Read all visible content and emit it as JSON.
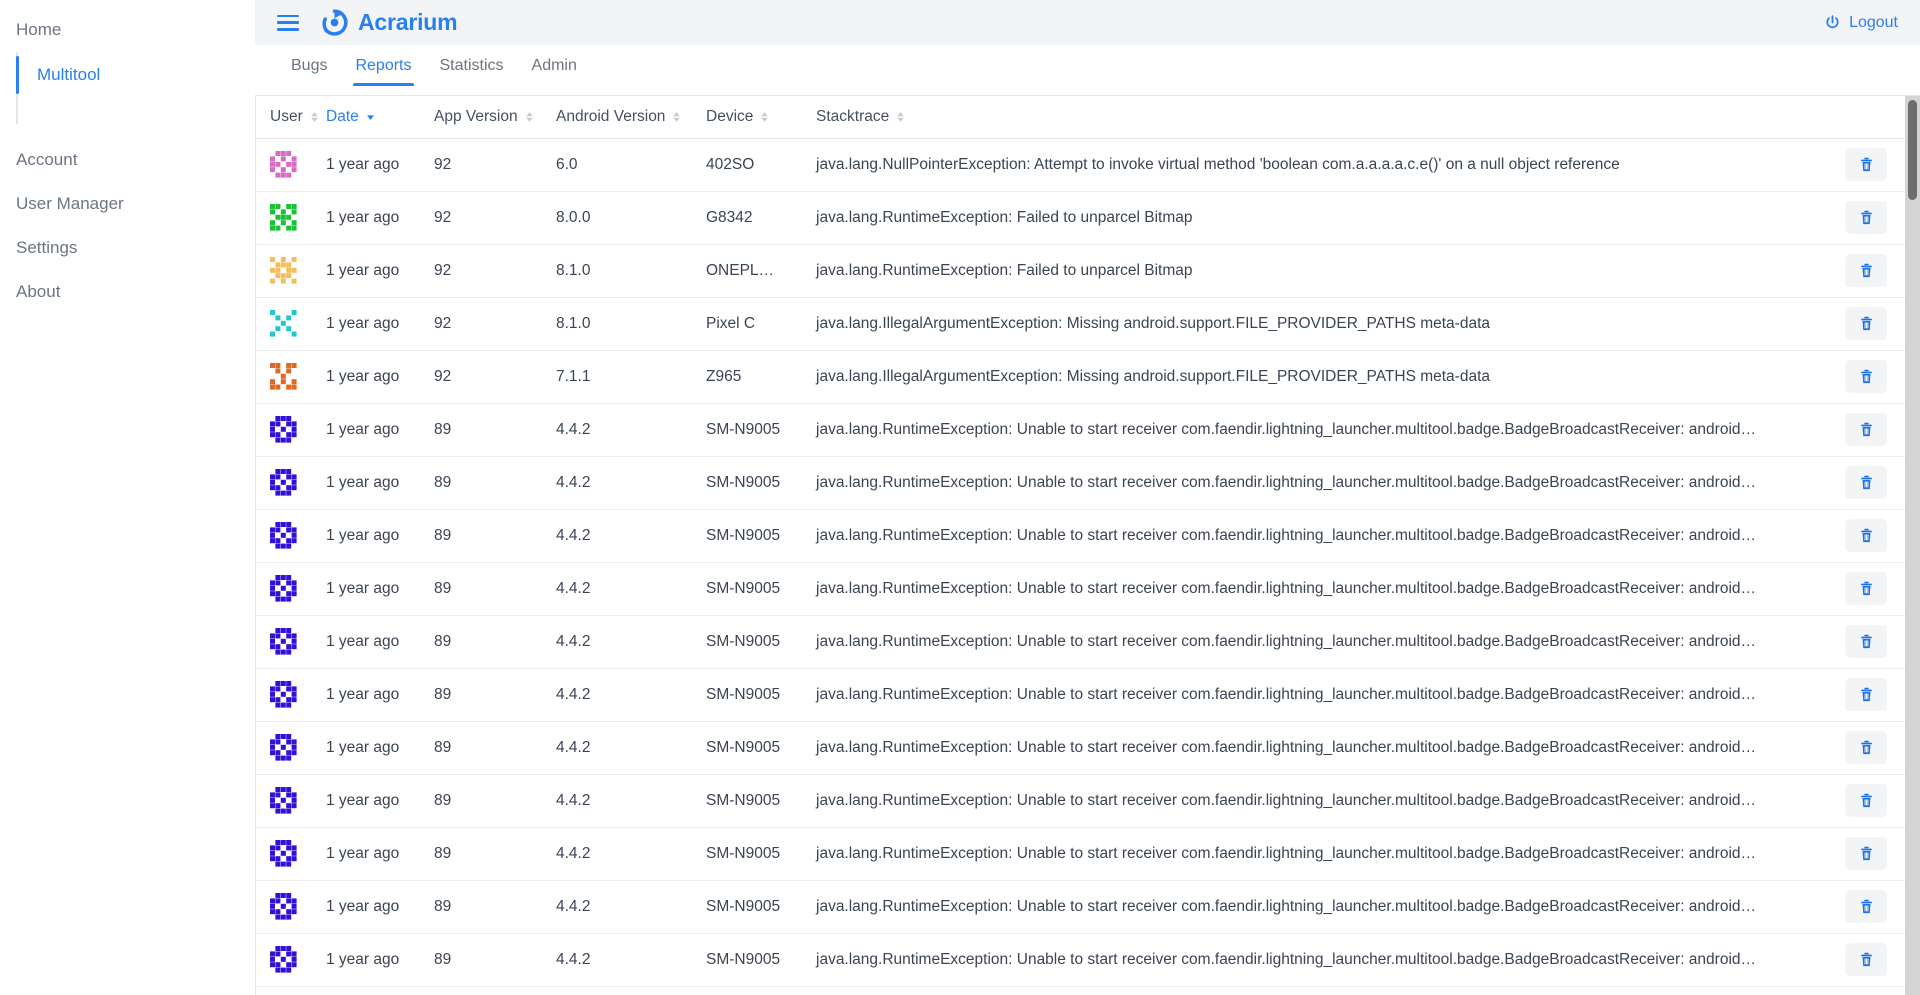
{
  "sidebar": {
    "items": [
      {
        "label": "Home",
        "type": "top"
      },
      {
        "label": "Multitool",
        "type": "sub",
        "active": true
      },
      {
        "label": "Account",
        "type": "top"
      },
      {
        "label": "User Manager",
        "type": "top"
      },
      {
        "label": "Settings",
        "type": "top"
      },
      {
        "label": "About",
        "type": "top"
      }
    ]
  },
  "header": {
    "menu_icon": "hamburger-icon",
    "logo_icon": "acrarium-logo-icon",
    "brand": "Acrarium",
    "logout_label": "Logout",
    "logout_icon": "power-icon"
  },
  "tabs": [
    {
      "label": "Bugs",
      "active": false
    },
    {
      "label": "Reports",
      "active": true
    },
    {
      "label": "Statistics",
      "active": false
    },
    {
      "label": "Admin",
      "active": false
    }
  ],
  "table": {
    "columns": [
      {
        "label": "User",
        "sortable": true,
        "sorted": false,
        "direction": "none"
      },
      {
        "label": "Date",
        "sortable": true,
        "sorted": true,
        "direction": "desc"
      },
      {
        "label": "App Version",
        "sortable": true,
        "sorted": false,
        "direction": "none"
      },
      {
        "label": "Android Version",
        "sortable": true,
        "sorted": false,
        "direction": "none"
      },
      {
        "label": "Device",
        "sortable": true,
        "sorted": false,
        "direction": "none"
      },
      {
        "label": "Stacktrace",
        "sortable": true,
        "sorted": false,
        "direction": "none"
      }
    ],
    "delete_icon": "trash-icon",
    "rows": [
      {
        "avatar_color": "#d86bc4",
        "avatar_seed": 1,
        "date": "1 year ago",
        "app_version": "92",
        "android_version": "6.0",
        "device": "402SO",
        "stacktrace": "java.lang.NullPointerException: Attempt to invoke virtual method 'boolean com.a.a.a.a.c.e()' on a null object reference"
      },
      {
        "avatar_color": "#17c234",
        "avatar_seed": 2,
        "date": "1 year ago",
        "app_version": "92",
        "android_version": "8.0.0",
        "device": "G8342",
        "stacktrace": "java.lang.RuntimeException: Failed to unparcel Bitmap"
      },
      {
        "avatar_color": "#f4bd5e",
        "avatar_seed": 3,
        "date": "1 year ago",
        "app_version": "92",
        "android_version": "8.1.0",
        "device": "ONEPL…",
        "stacktrace": "java.lang.RuntimeException: Failed to unparcel Bitmap"
      },
      {
        "avatar_color": "#22c6cf",
        "avatar_seed": 4,
        "date": "1 year ago",
        "app_version": "92",
        "android_version": "8.1.0",
        "device": "Pixel C",
        "stacktrace": "java.lang.IllegalArgumentException: Missing android.support.FILE_PROVIDER_PATHS meta-data"
      },
      {
        "avatar_color": "#e06820",
        "avatar_seed": 5,
        "date": "1 year ago",
        "app_version": "92",
        "android_version": "7.1.1",
        "device": "Z965",
        "stacktrace": "java.lang.IllegalArgumentException: Missing android.support.FILE_PROVIDER_PATHS meta-data"
      },
      {
        "avatar_color": "#3110d8",
        "avatar_seed": 6,
        "date": "1 year ago",
        "app_version": "89",
        "android_version": "4.4.2",
        "device": "SM-N9005",
        "stacktrace": "java.lang.RuntimeException: Unable to start receiver com.faendir.lightning_launcher.multitool.badge.BadgeBroadcastReceiver: android…"
      },
      {
        "avatar_color": "#3110d8",
        "avatar_seed": 6,
        "date": "1 year ago",
        "app_version": "89",
        "android_version": "4.4.2",
        "device": "SM-N9005",
        "stacktrace": "java.lang.RuntimeException: Unable to start receiver com.faendir.lightning_launcher.multitool.badge.BadgeBroadcastReceiver: android…"
      },
      {
        "avatar_color": "#3110d8",
        "avatar_seed": 6,
        "date": "1 year ago",
        "app_version": "89",
        "android_version": "4.4.2",
        "device": "SM-N9005",
        "stacktrace": "java.lang.RuntimeException: Unable to start receiver com.faendir.lightning_launcher.multitool.badge.BadgeBroadcastReceiver: android…"
      },
      {
        "avatar_color": "#3110d8",
        "avatar_seed": 6,
        "date": "1 year ago",
        "app_version": "89",
        "android_version": "4.4.2",
        "device": "SM-N9005",
        "stacktrace": "java.lang.RuntimeException: Unable to start receiver com.faendir.lightning_launcher.multitool.badge.BadgeBroadcastReceiver: android…"
      },
      {
        "avatar_color": "#3110d8",
        "avatar_seed": 6,
        "date": "1 year ago",
        "app_version": "89",
        "android_version": "4.4.2",
        "device": "SM-N9005",
        "stacktrace": "java.lang.RuntimeException: Unable to start receiver com.faendir.lightning_launcher.multitool.badge.BadgeBroadcastReceiver: android…"
      },
      {
        "avatar_color": "#3110d8",
        "avatar_seed": 6,
        "date": "1 year ago",
        "app_version": "89",
        "android_version": "4.4.2",
        "device": "SM-N9005",
        "stacktrace": "java.lang.RuntimeException: Unable to start receiver com.faendir.lightning_launcher.multitool.badge.BadgeBroadcastReceiver: android…"
      },
      {
        "avatar_color": "#3110d8",
        "avatar_seed": 6,
        "date": "1 year ago",
        "app_version": "89",
        "android_version": "4.4.2",
        "device": "SM-N9005",
        "stacktrace": "java.lang.RuntimeException: Unable to start receiver com.faendir.lightning_launcher.multitool.badge.BadgeBroadcastReceiver: android…"
      },
      {
        "avatar_color": "#3110d8",
        "avatar_seed": 6,
        "date": "1 year ago",
        "app_version": "89",
        "android_version": "4.4.2",
        "device": "SM-N9005",
        "stacktrace": "java.lang.RuntimeException: Unable to start receiver com.faendir.lightning_launcher.multitool.badge.BadgeBroadcastReceiver: android…"
      },
      {
        "avatar_color": "#3110d8",
        "avatar_seed": 6,
        "date": "1 year ago",
        "app_version": "89",
        "android_version": "4.4.2",
        "device": "SM-N9005",
        "stacktrace": "java.lang.RuntimeException: Unable to start receiver com.faendir.lightning_launcher.multitool.badge.BadgeBroadcastReceiver: android…"
      },
      {
        "avatar_color": "#3110d8",
        "avatar_seed": 6,
        "date": "1 year ago",
        "app_version": "89",
        "android_version": "4.4.2",
        "device": "SM-N9005",
        "stacktrace": "java.lang.RuntimeException: Unable to start receiver com.faendir.lightning_launcher.multitool.badge.BadgeBroadcastReceiver: android…"
      },
      {
        "avatar_color": "#3110d8",
        "avatar_seed": 6,
        "date": "1 year ago",
        "app_version": "89",
        "android_version": "4.4.2",
        "device": "SM-N9005",
        "stacktrace": "java.lang.RuntimeException: Unable to start receiver com.faendir.lightning_launcher.multitool.badge.BadgeBroadcastReceiver: android…"
      }
    ]
  },
  "colors": {
    "accent": "#2a7ff0",
    "text": "#3b4453",
    "muted": "#6c7581",
    "border": "#e3e6ea",
    "topbar_bg": "#f3f4f6"
  }
}
